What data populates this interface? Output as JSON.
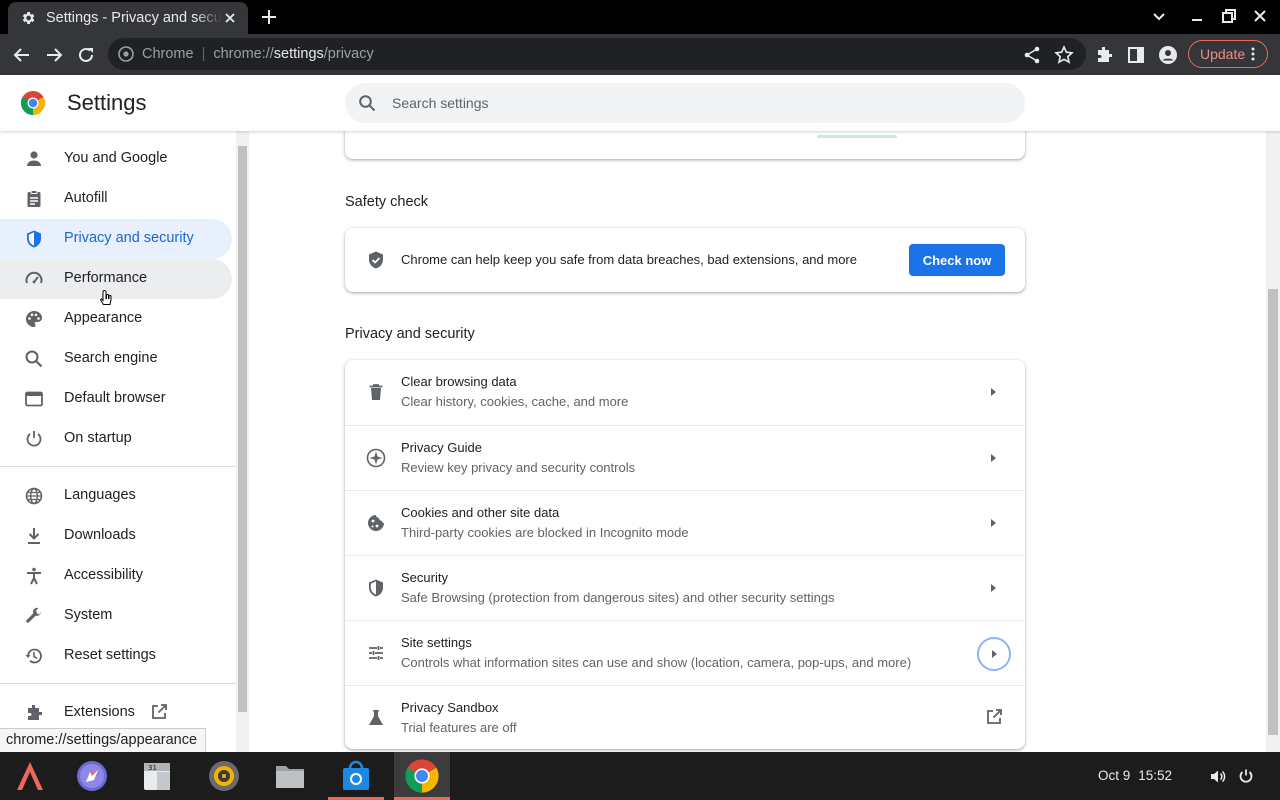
{
  "browser": {
    "tab_title": "Settings - Privacy and security",
    "omnibox_chip": "Chrome",
    "url_scheme": "chrome://",
    "url_host": "settings",
    "url_path": "/privacy",
    "update_label": "Update"
  },
  "header": {
    "title": "Settings",
    "search_placeholder": "Search settings"
  },
  "sidebar": {
    "items": [
      {
        "label": "You and Google",
        "icon": "person-icon"
      },
      {
        "label": "Autofill",
        "icon": "clipboard-icon"
      },
      {
        "label": "Privacy and security",
        "icon": "shield-icon",
        "selected": true
      },
      {
        "label": "Performance",
        "icon": "speedometer-icon",
        "hovered": true
      },
      {
        "label": "Appearance",
        "icon": "palette-icon"
      },
      {
        "label": "Search engine",
        "icon": "search-icon"
      },
      {
        "label": "Default browser",
        "icon": "browser-window-icon"
      },
      {
        "label": "On startup",
        "icon": "power-icon"
      },
      {
        "label": "Languages",
        "icon": "globe-icon"
      },
      {
        "label": "Downloads",
        "icon": "download-icon"
      },
      {
        "label": "Accessibility",
        "icon": "accessibility-icon"
      },
      {
        "label": "System",
        "icon": "wrench-icon"
      },
      {
        "label": "Reset settings",
        "icon": "history-icon"
      },
      {
        "label": "Extensions",
        "icon": "puzzle-icon"
      }
    ],
    "status_url": "chrome://settings/appearance"
  },
  "safety_check": {
    "title": "Safety check",
    "text": "Chrome can help keep you safe from data breaches, bad extensions, and more",
    "button": "Check now"
  },
  "privacy": {
    "title": "Privacy and security",
    "rows": [
      {
        "title": "Clear browsing data",
        "sub": "Clear history, cookies, cache, and more",
        "icon": "trash-icon"
      },
      {
        "title": "Privacy Guide",
        "sub": "Review key privacy and security controls",
        "icon": "compass-icon"
      },
      {
        "title": "Cookies and other site data",
        "sub": "Third-party cookies are blocked in Incognito mode",
        "icon": "cookie-icon"
      },
      {
        "title": "Security",
        "sub": "Safe Browsing (protection from dangerous sites) and other security settings",
        "icon": "shield-half-icon"
      },
      {
        "title": "Site settings",
        "sub": "Controls what information sites can use and show (location, camera, pop-ups, and more)",
        "icon": "sliders-icon"
      },
      {
        "title": "Privacy Sandbox",
        "sub": "Trial features are off",
        "icon": "flask-icon"
      }
    ]
  },
  "taskbar": {
    "date": "Oct 9",
    "time": "15:52",
    "accent": "#ee675c"
  }
}
